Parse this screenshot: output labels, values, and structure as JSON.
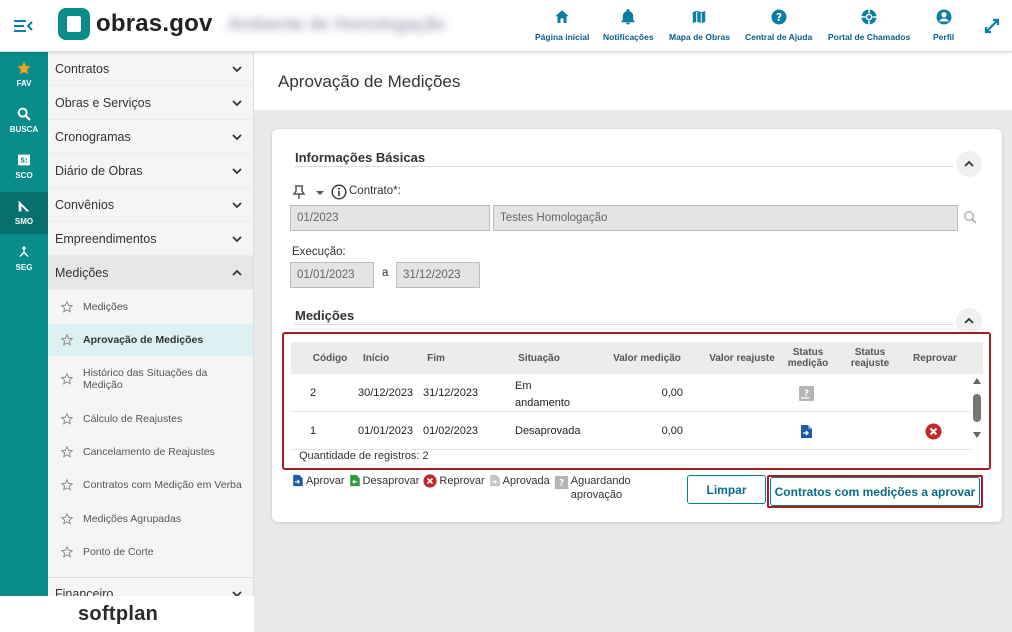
{
  "app": {
    "logo_text": "obras.gov",
    "environment": "Ambiente de Homologação",
    "brand": "softplan"
  },
  "topnav": [
    {
      "label": "Página inicial",
      "icon": "home-icon"
    },
    {
      "label": "Notificações",
      "icon": "bell-icon"
    },
    {
      "label": "Mapa de Obras",
      "icon": "map-icon"
    },
    {
      "label": "Central de Ajuda",
      "icon": "help-icon"
    },
    {
      "label": "Portal de Chamados",
      "icon": "lifebuoy-icon"
    },
    {
      "label": "Perfil",
      "icon": "user-icon"
    }
  ],
  "rail": [
    {
      "label": "FAV",
      "icon": "star-icon"
    },
    {
      "label": "BUSCA",
      "icon": "search-icon"
    },
    {
      "label": "SCO",
      "icon": "sco-icon"
    },
    {
      "label": "SMO",
      "icon": "ruler-icon"
    },
    {
      "label": "SEG",
      "icon": "merge-icon"
    }
  ],
  "sidebar": {
    "sections": [
      "Contratos",
      "Obras e Serviços",
      "Cronogramas",
      "Diário de Obras",
      "Convênios",
      "Empreendimentos",
      "Medições"
    ],
    "items": [
      "Medições",
      "Aprovação de Medições",
      "Histórico das Situações da Medição",
      "Cálculo de Reajustes",
      "Cancelamento de Reajustes",
      "Contratos com Medição em Verba",
      "Medições Agrupadas",
      "Ponto de Corte"
    ],
    "footer_section": "Financeiro"
  },
  "page": {
    "title": "Aprovação de Medições"
  },
  "basic_info": {
    "title": "Informações Básicas",
    "contract_label": "Contrato*:",
    "contract_number": "01/2023",
    "contract_name": "Testes Homologação",
    "execution_label": "Execução:",
    "execution_start": "01/01/2023",
    "execution_sep": "a",
    "execution_end": "31/12/2023"
  },
  "measurements": {
    "title": "Medições",
    "columns": [
      "Código",
      "Início",
      "Fim",
      "Situação",
      "Valor medição",
      "Valor reajuste",
      "Status medição",
      "Status reajuste",
      "Reprovar"
    ],
    "rows": [
      {
        "code": "2",
        "start": "30/12/2023",
        "end": "31/12/2023",
        "situation": "Em andamento",
        "value": "0,00",
        "adjust": "",
        "status_icon": "awaiting-approval-icon",
        "reject": false
      },
      {
        "code": "1",
        "start": "01/01/2023",
        "end": "01/02/2023",
        "situation": "Desaprovada",
        "value": "0,00",
        "adjust": "",
        "status_icon": "approve-doc-icon",
        "reject": true
      }
    ],
    "count_label": "Quantidade de registros: 2"
  },
  "legend": [
    {
      "label": "Aprovar",
      "icon": "approve-doc-icon",
      "color": "#1e5aa8"
    },
    {
      "label": "Desaprovar",
      "icon": "disapprove-doc-icon",
      "color": "#2e9a3c"
    },
    {
      "label": "Reprovar",
      "icon": "reject-icon",
      "color": "#c0282d"
    },
    {
      "label": "Aprovada",
      "icon": "approved-doc-icon",
      "color": "#bbbbbb"
    },
    {
      "label": "Aguardando aprovação",
      "icon": "awaiting-approval-icon",
      "color": "#999999"
    }
  ],
  "buttons": {
    "clear": "Limpar",
    "contracts": "Contratos com medições a aprovar"
  },
  "colors": {
    "brand": "#0a8d8a",
    "accent": "#0a6a8a",
    "highlight": "#a31d22"
  }
}
